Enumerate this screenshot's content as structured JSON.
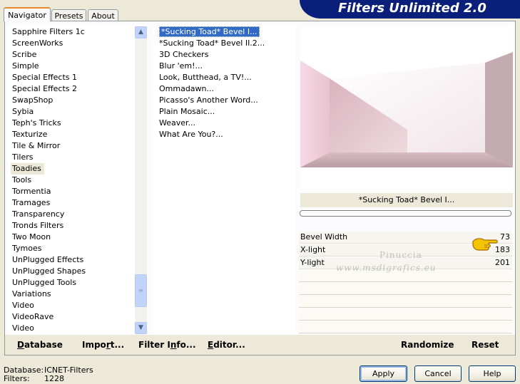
{
  "app": {
    "title": "Filters Unlimited 2.0",
    "colors": {
      "banner": "#0a1f7a",
      "selection": "#316ac5",
      "tab_accent": "#e68b2c"
    }
  },
  "tabs": [
    {
      "label": "Navigator",
      "active": true
    },
    {
      "label": "Presets",
      "active": false
    },
    {
      "label": "About",
      "active": false
    }
  ],
  "categories": {
    "items": [
      "Sapphire Filters 1c",
      "ScreenWorks",
      "Scribe",
      "Simple",
      "Special Effects 1",
      "Special Effects 2",
      "SwapShop",
      "Sybia",
      "Teph's Tricks",
      "Texturize",
      "Tile & Mirror",
      "Tilers",
      "Toadies",
      "Tools",
      "Tormentia",
      "Tramages",
      "Transparency",
      "Tronds Filters",
      "Two Moon",
      "Tymoes",
      "UnPlugged Effects",
      "UnPlugged Shapes",
      "UnPlugged Tools",
      "Variations",
      "Video",
      "VideoRave",
      "Video"
    ],
    "selected": "Toadies"
  },
  "filters": {
    "items": [
      "*Sucking Toad*  Bevel I...",
      "*Sucking Toad*  Bevel II.2...",
      "3D Checkers",
      "Blur 'em!...",
      "Look, Butthead, a TV!...",
      "Ommadawn...",
      "Picasso's Another Word...",
      "Plain Mosaic...",
      "Weaver...",
      "What Are You?..."
    ],
    "selected": "*Sucking Toad*  Bevel I..."
  },
  "buttons": {
    "database": "Database",
    "import": "Import...",
    "filter_info": "Filter Info...",
    "editor": "Editor...",
    "randomize": "Randomize",
    "reset": "Reset",
    "apply": "Apply",
    "cancel": "Cancel",
    "help": "Help"
  },
  "preview": {
    "filter_name": "*Sucking Toad*  Bevel I..."
  },
  "params": [
    {
      "label": "Bevel Width",
      "value": "73"
    },
    {
      "label": "X-light",
      "value": "183"
    },
    {
      "label": "Y-light",
      "value": "201"
    }
  ],
  "watermark": {
    "line1": "Pinuccia",
    "line2": "www.msdigrafics.eu"
  },
  "status": {
    "database_label": "Database:",
    "database_value": "ICNET-Filters",
    "filters_label": "Filters:",
    "filters_value": "1228"
  },
  "icons": [
    "pointing-hand-icon",
    "scroll-up-icon",
    "scroll-down-icon",
    "scroll-thumb-grip-icon"
  ]
}
